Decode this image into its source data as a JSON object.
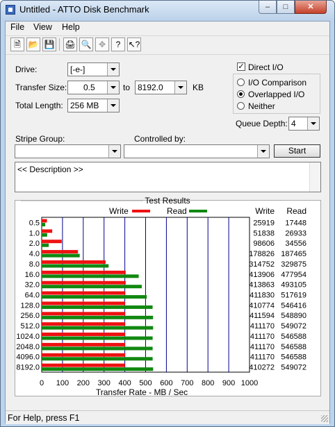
{
  "window": {
    "title": "Untitled - ATTO Disk Benchmark"
  },
  "menu": [
    "File",
    "View",
    "Help"
  ],
  "toolbar_icons": [
    "new-icon",
    "open-icon",
    "save-icon",
    "print-icon",
    "print-preview-icon",
    "move-icon",
    "help-icon",
    "context-help-icon"
  ],
  "form": {
    "drive_label": "Drive:",
    "drive_value": "[-e-]",
    "transfer_label": "Transfer Size:",
    "transfer_from": "0.5",
    "to_label": "to",
    "transfer_to": "8192.0",
    "kb_label": "KB",
    "total_label": "Total Length:",
    "total_value": "256 MB",
    "direct_io": "Direct I/O",
    "io_comparison": "I/O Comparison",
    "overlapped_io": "Overlapped I/O",
    "neither": "Neither",
    "queue_label": "Queue Depth:",
    "queue_value": "4",
    "stripe_label": "Stripe Group:",
    "controlled_label": "Controlled by:",
    "start_label": "Start",
    "description": "<< Description >>"
  },
  "status": "For Help, press F1",
  "chart_data": {
    "type": "bar",
    "title": "Test Results",
    "xlabel": "Transfer Rate - MB / Sec",
    "xlim": [
      0,
      1000
    ],
    "xticks": [
      "0",
      "100",
      "200",
      "300",
      "400",
      "500",
      "600",
      "700",
      "800",
      "900",
      "1000"
    ],
    "categories": [
      "0.5",
      "1.0",
      "2.0",
      "4.0",
      "8.0",
      "16.0",
      "32.0",
      "64.0",
      "128.0",
      "256.0",
      "512.0",
      "1024.0",
      "2048.0",
      "4096.0",
      "8192.0"
    ],
    "series": [
      {
        "name": "Write",
        "color": "#ee1111",
        "values": [
          25.3,
          50.6,
          96.3,
          174.6,
          307.4,
          404.2,
          404.2,
          402.2,
          401.1,
          401.9,
          401.5,
          401.5,
          401.5,
          401.5,
          400.7
        ]
      },
      {
        "name": "Read",
        "color": "#118811",
        "values": [
          17.0,
          26.3,
          33.7,
          182.9,
          321.9,
          466.8,
          481.5,
          505.4,
          533.6,
          536.0,
          536.2,
          533.8,
          533.8,
          533.8,
          536.2
        ]
      }
    ],
    "col_headers": [
      "Write",
      "Read"
    ],
    "write_numbers": [
      "25919",
      "51838",
      "98606",
      "178826",
      "314752",
      "413906",
      "413863",
      "411830",
      "410774",
      "411594",
      "411170",
      "411170",
      "411170",
      "411170",
      "410272"
    ],
    "read_numbers": [
      "17448",
      "26933",
      "34556",
      "187465",
      "329875",
      "477954",
      "493105",
      "517619",
      "546416",
      "548890",
      "549072",
      "546588",
      "546588",
      "546588",
      "549072"
    ]
  }
}
